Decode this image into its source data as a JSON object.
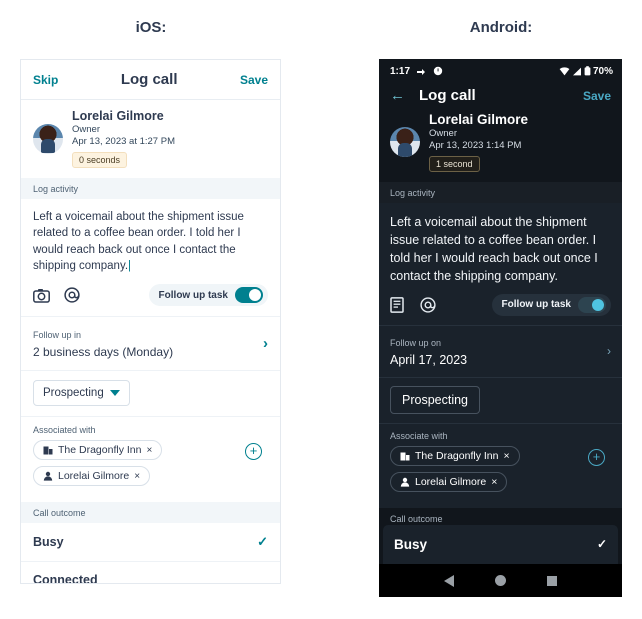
{
  "sections": {
    "ios_title": "iOS:",
    "android_title": "Android:"
  },
  "colors": {
    "ios_accent": "#00808f",
    "android_accent": "#4aa8c4",
    "ios_bg": "#ffffff",
    "android_bg": "#11161c",
    "badge_bg": "#fdf3e0"
  },
  "ios": {
    "navbar": {
      "skip": "Skip",
      "title": "Log call",
      "save": "Save"
    },
    "contact": {
      "name": "Lorelai Gilmore",
      "role": "Owner",
      "datetime": "Apr 13, 2023 at 1:27 PM",
      "duration": "0 seconds"
    },
    "log_activity": {
      "label": "Log activity",
      "note": "Left a voicemail about the shipment issue related to a coffee bean order. I told her I would reach back out once I contact the shipping company."
    },
    "tools": {
      "camera_icon": "camera-icon",
      "mention_icon": "mention-icon",
      "follow_up_task_label": "Follow up task",
      "follow_up_task_on": true
    },
    "follow_up": {
      "label": "Follow up in",
      "value": "2 business days (Monday)"
    },
    "stage": {
      "value": "Prospecting"
    },
    "associations": {
      "label": "Associated with",
      "chips": [
        {
          "icon": "company-icon",
          "label": "The Dragonfly Inn",
          "remove": "×"
        },
        {
          "icon": "contact-icon",
          "label": "Lorelai Gilmore",
          "remove": "×"
        }
      ],
      "add_label": "+"
    },
    "call_outcome": {
      "label": "Call outcome",
      "options": [
        {
          "label": "Busy",
          "selected": true
        },
        {
          "label": "Connected",
          "selected": false
        }
      ]
    }
  },
  "android": {
    "status_bar": {
      "time": "1:17",
      "battery": "70%"
    },
    "navbar": {
      "back_icon": "arrow-left-icon",
      "title": "Log call",
      "save": "Save"
    },
    "contact": {
      "name": "Lorelai Gilmore",
      "role": "Owner",
      "datetime": "Apr 13, 2023 1:14 PM",
      "duration": "1 second"
    },
    "log_activity": {
      "label": "Log activity",
      "note": "Left a voicemail about the shipment issue related to a coffee bean order. I told her I would reach back out once I contact the shipping company."
    },
    "tools": {
      "note_icon": "note-icon",
      "mention_icon": "mention-icon",
      "follow_up_task_label": "Follow up task",
      "follow_up_task_on": true
    },
    "follow_up": {
      "label": "Follow up on",
      "value": "April 17, 2023"
    },
    "stage": {
      "value": "Prospecting"
    },
    "associations": {
      "label": "Associate with",
      "chips": [
        {
          "icon": "company-icon",
          "label": "The Dragonfly Inn",
          "remove": "×"
        },
        {
          "icon": "contact-icon",
          "label": "Lorelai Gilmore",
          "remove": "×"
        }
      ],
      "add_label": "+"
    },
    "call_outcome": {
      "label": "Call outcome",
      "options": [
        {
          "label": "Busy",
          "selected": true
        }
      ]
    },
    "system_nav": {
      "back": "back-nav",
      "home": "home-nav",
      "recents": "recents-nav"
    }
  }
}
